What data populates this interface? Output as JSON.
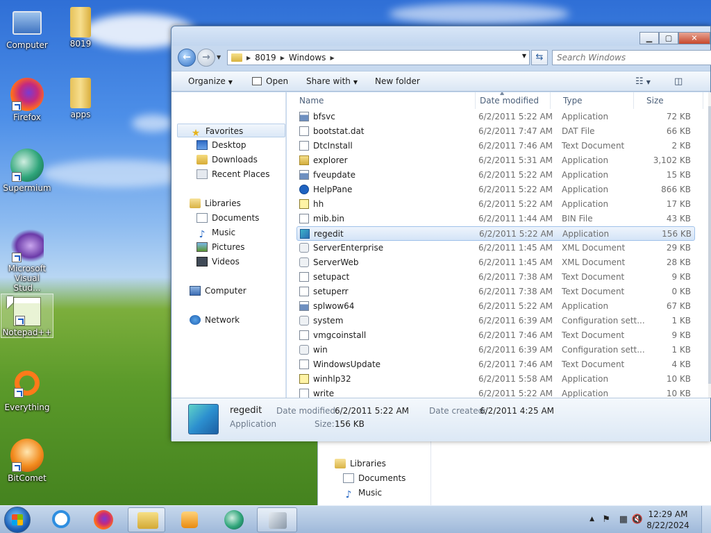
{
  "desktop": {
    "icons": [
      {
        "label": "Computer"
      },
      {
        "label": "8019"
      },
      {
        "label": "Firefox"
      },
      {
        "label": "apps"
      },
      {
        "label": "Supermium"
      },
      {
        "label": "Microsoft Visual Stud..."
      },
      {
        "label": "Notepad++"
      },
      {
        "label": "Everything"
      },
      {
        "label": "BitComet"
      }
    ]
  },
  "bg_window": {
    "nav": [
      "Libraries",
      "Documents",
      "Music"
    ]
  },
  "window": {
    "address": {
      "crumbs": [
        "8019",
        "Windows"
      ],
      "search_placeholder": "Search Windows"
    },
    "toolbar": {
      "organize": "Organize",
      "open": "Open",
      "share_with": "Share with",
      "new_folder": "New folder"
    },
    "nav": {
      "favorites": "Favorites",
      "desktop": "Desktop",
      "downloads": "Downloads",
      "recent": "Recent Places",
      "libraries": "Libraries",
      "documents": "Documents",
      "music": "Music",
      "pictures": "Pictures",
      "videos": "Videos",
      "computer": "Computer",
      "network": "Network"
    },
    "columns": {
      "name": "Name",
      "date": "Date modified",
      "type": "Type",
      "size": "Size"
    },
    "files": [
      {
        "name": "bfsvc",
        "date": "6/2/2011 5:22 AM",
        "type": "Application",
        "size": "72 KB",
        "icon": "app"
      },
      {
        "name": "bootstat.dat",
        "date": "6/2/2011 7:47 AM",
        "type": "DAT File",
        "size": "66 KB",
        "icon": "file"
      },
      {
        "name": "DtcInstall",
        "date": "6/2/2011 7:46 AM",
        "type": "Text Document",
        "size": "2 KB",
        "icon": "file"
      },
      {
        "name": "explorer",
        "date": "6/2/2011 5:31 AM",
        "type": "Application",
        "size": "3,102 KB",
        "icon": "folder"
      },
      {
        "name": "fveupdate",
        "date": "6/2/2011 5:22 AM",
        "type": "Application",
        "size": "15 KB",
        "icon": "app"
      },
      {
        "name": "HelpPane",
        "date": "6/2/2011 5:22 AM",
        "type": "Application",
        "size": "866 KB",
        "icon": "help"
      },
      {
        "name": "hh",
        "date": "6/2/2011 5:22 AM",
        "type": "Application",
        "size": "17 KB",
        "icon": "chm"
      },
      {
        "name": "mib.bin",
        "date": "6/2/2011 1:44 AM",
        "type": "BIN File",
        "size": "43 KB",
        "icon": "file"
      },
      {
        "name": "regedit",
        "date": "6/2/2011 5:22 AM",
        "type": "Application",
        "size": "156 KB",
        "icon": "reg"
      },
      {
        "name": "ServerEnterprise",
        "date": "6/2/2011 1:45 AM",
        "type": "XML Document",
        "size": "29 KB",
        "icon": "cfg"
      },
      {
        "name": "ServerWeb",
        "date": "6/2/2011 1:45 AM",
        "type": "XML Document",
        "size": "28 KB",
        "icon": "cfg"
      },
      {
        "name": "setupact",
        "date": "6/2/2011 7:38 AM",
        "type": "Text Document",
        "size": "9 KB",
        "icon": "file"
      },
      {
        "name": "setuperr",
        "date": "6/2/2011 7:38 AM",
        "type": "Text Document",
        "size": "0 KB",
        "icon": "file"
      },
      {
        "name": "splwow64",
        "date": "6/2/2011 5:22 AM",
        "type": "Application",
        "size": "67 KB",
        "icon": "app"
      },
      {
        "name": "system",
        "date": "6/2/2011 6:39 AM",
        "type": "Configuration sett...",
        "size": "1 KB",
        "icon": "cfg"
      },
      {
        "name": "vmgcoinstall",
        "date": "6/2/2011 7:46 AM",
        "type": "Text Document",
        "size": "9 KB",
        "icon": "file"
      },
      {
        "name": "win",
        "date": "6/2/2011 6:39 AM",
        "type": "Configuration sett...",
        "size": "1 KB",
        "icon": "cfg"
      },
      {
        "name": "WindowsUpdate",
        "date": "6/2/2011 7:46 AM",
        "type": "Text Document",
        "size": "4 KB",
        "icon": "file"
      },
      {
        "name": "winhlp32",
        "date": "6/2/2011 5:58 AM",
        "type": "Application",
        "size": "10 KB",
        "icon": "chm"
      },
      {
        "name": "write",
        "date": "6/2/2011 5:22 AM",
        "type": "Application",
        "size": "10 KB",
        "icon": "file"
      }
    ],
    "selected_index": 8,
    "details": {
      "name": "regedit",
      "kind": "Application",
      "date_modified_label": "Date modified:",
      "date_modified": "6/2/2011 5:22 AM",
      "size_label": "Size:",
      "size": "156 KB",
      "date_created_label": "Date created:",
      "date_created": "6/2/2011 4:25 AM"
    }
  },
  "taskbar": {
    "time": "12:29 AM",
    "date": "8/22/2024"
  },
  "colors": {
    "selection": "#d4e4f7",
    "window_frame": "#c7d9ef",
    "taskbar": "#b3c8e2"
  }
}
